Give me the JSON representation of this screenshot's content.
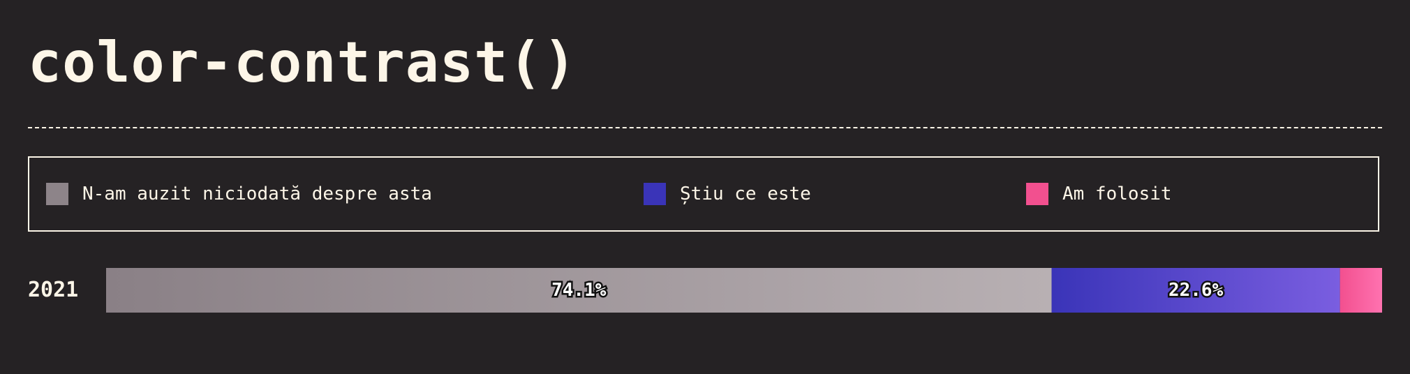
{
  "title": "color-contrast()",
  "chart_data": {
    "type": "bar",
    "orientation": "horizontal-stacked-percent",
    "categories": [
      "2021"
    ],
    "series": [
      {
        "name": "N-am auzit niciodată despre asta",
        "values": [
          74.1
        ],
        "label": "74.1%",
        "color": "#8d8489"
      },
      {
        "name": "Știu ce este",
        "values": [
          22.6
        ],
        "label": "22.6%",
        "color": "#3a34b8"
      },
      {
        "name": "Am folosit",
        "values": [
          3.3
        ],
        "label": "",
        "color": "#f2508f"
      }
    ],
    "xlim": [
      0,
      100
    ],
    "legend": "top"
  }
}
